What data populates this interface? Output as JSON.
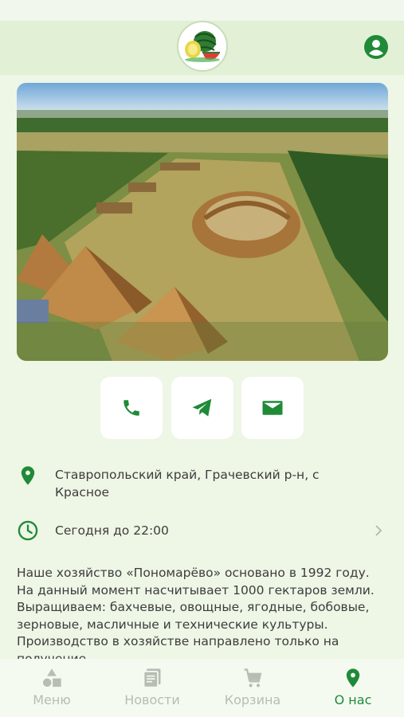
{
  "header": {
    "logo_icon": "watermelon-melon-logo",
    "profile_icon": "account-circle-icon"
  },
  "photo": {
    "subject": "aerial-farm-photo"
  },
  "contacts": [
    {
      "icon": "phone-icon"
    },
    {
      "icon": "telegram-icon"
    },
    {
      "icon": "email-icon"
    }
  ],
  "info": {
    "address": "Ставропольский край, Грачевский р-н, с Красное",
    "hours": "Сегодня до 22:00"
  },
  "description": "Наше хозяйство «Пономарёво» основано в 1992 году. На данный момент насчитывает 1000 гектаров земли. Выращиваем: бахчевые, овощные, ягодные, бобовые, зерновые, масличные и технические культуры. Производство в хозяйстве направлено только на получение",
  "tabs": [
    {
      "label": "Меню",
      "icon": "menu-shapes-icon"
    },
    {
      "label": "Новости",
      "icon": "news-icon"
    },
    {
      "label": "Корзина",
      "icon": "cart-icon"
    },
    {
      "label": "О нас",
      "icon": "location-pin-icon"
    }
  ],
  "colors": {
    "accent": "#1f8a37",
    "background": "#eef6e6",
    "header": "#e2f0d6",
    "inactive": "#b7bdb3"
  }
}
